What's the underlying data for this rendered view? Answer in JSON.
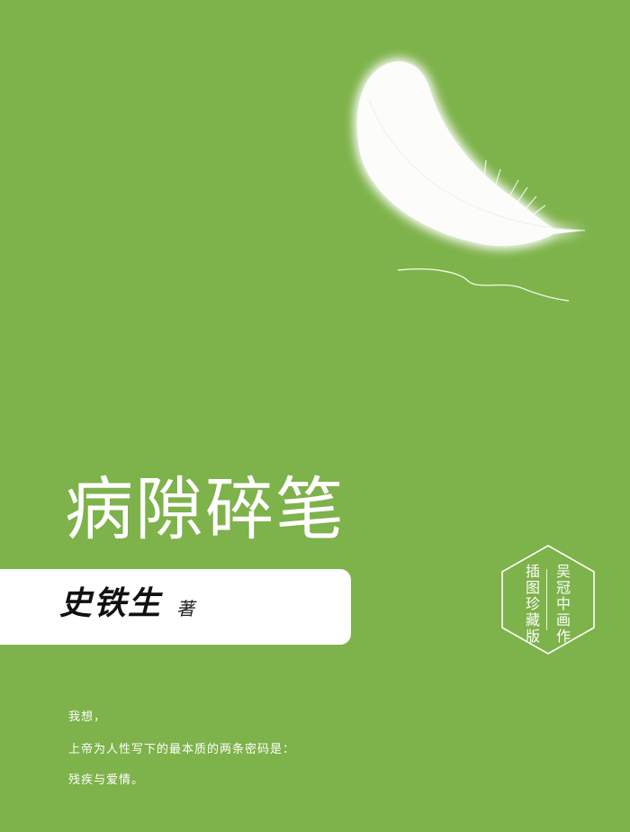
{
  "book": {
    "title": "病隙碎笔",
    "author": "史铁生",
    "author_role": "著"
  },
  "seal": {
    "right_column": "吴冠中画作",
    "left_column": "插图珍藏版"
  },
  "quote": [
    "我想，",
    "上帝为人性写下的最本质的两条密码是：",
    "残疾与爱情。"
  ],
  "colors": {
    "background": "#7eb24a",
    "feather": "#ffffff",
    "author_bar": "#ffffff",
    "text": "#ffffff"
  },
  "icons": {
    "feather": "feather-icon"
  }
}
